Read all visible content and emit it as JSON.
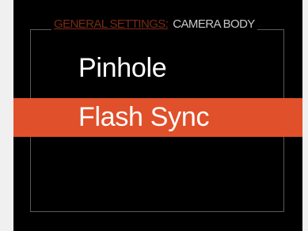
{
  "header": {
    "category": "GENERAL SETTINGS:",
    "section": "CAMERA BODY"
  },
  "menu": {
    "items": [
      {
        "label": "Pinhole",
        "selected": false
      },
      {
        "label": "Flash Sync",
        "selected": true
      }
    ]
  },
  "colors": {
    "selection_highlight": "#e0502a",
    "category_text": "#7a2a14",
    "screen_background": "#000000"
  }
}
